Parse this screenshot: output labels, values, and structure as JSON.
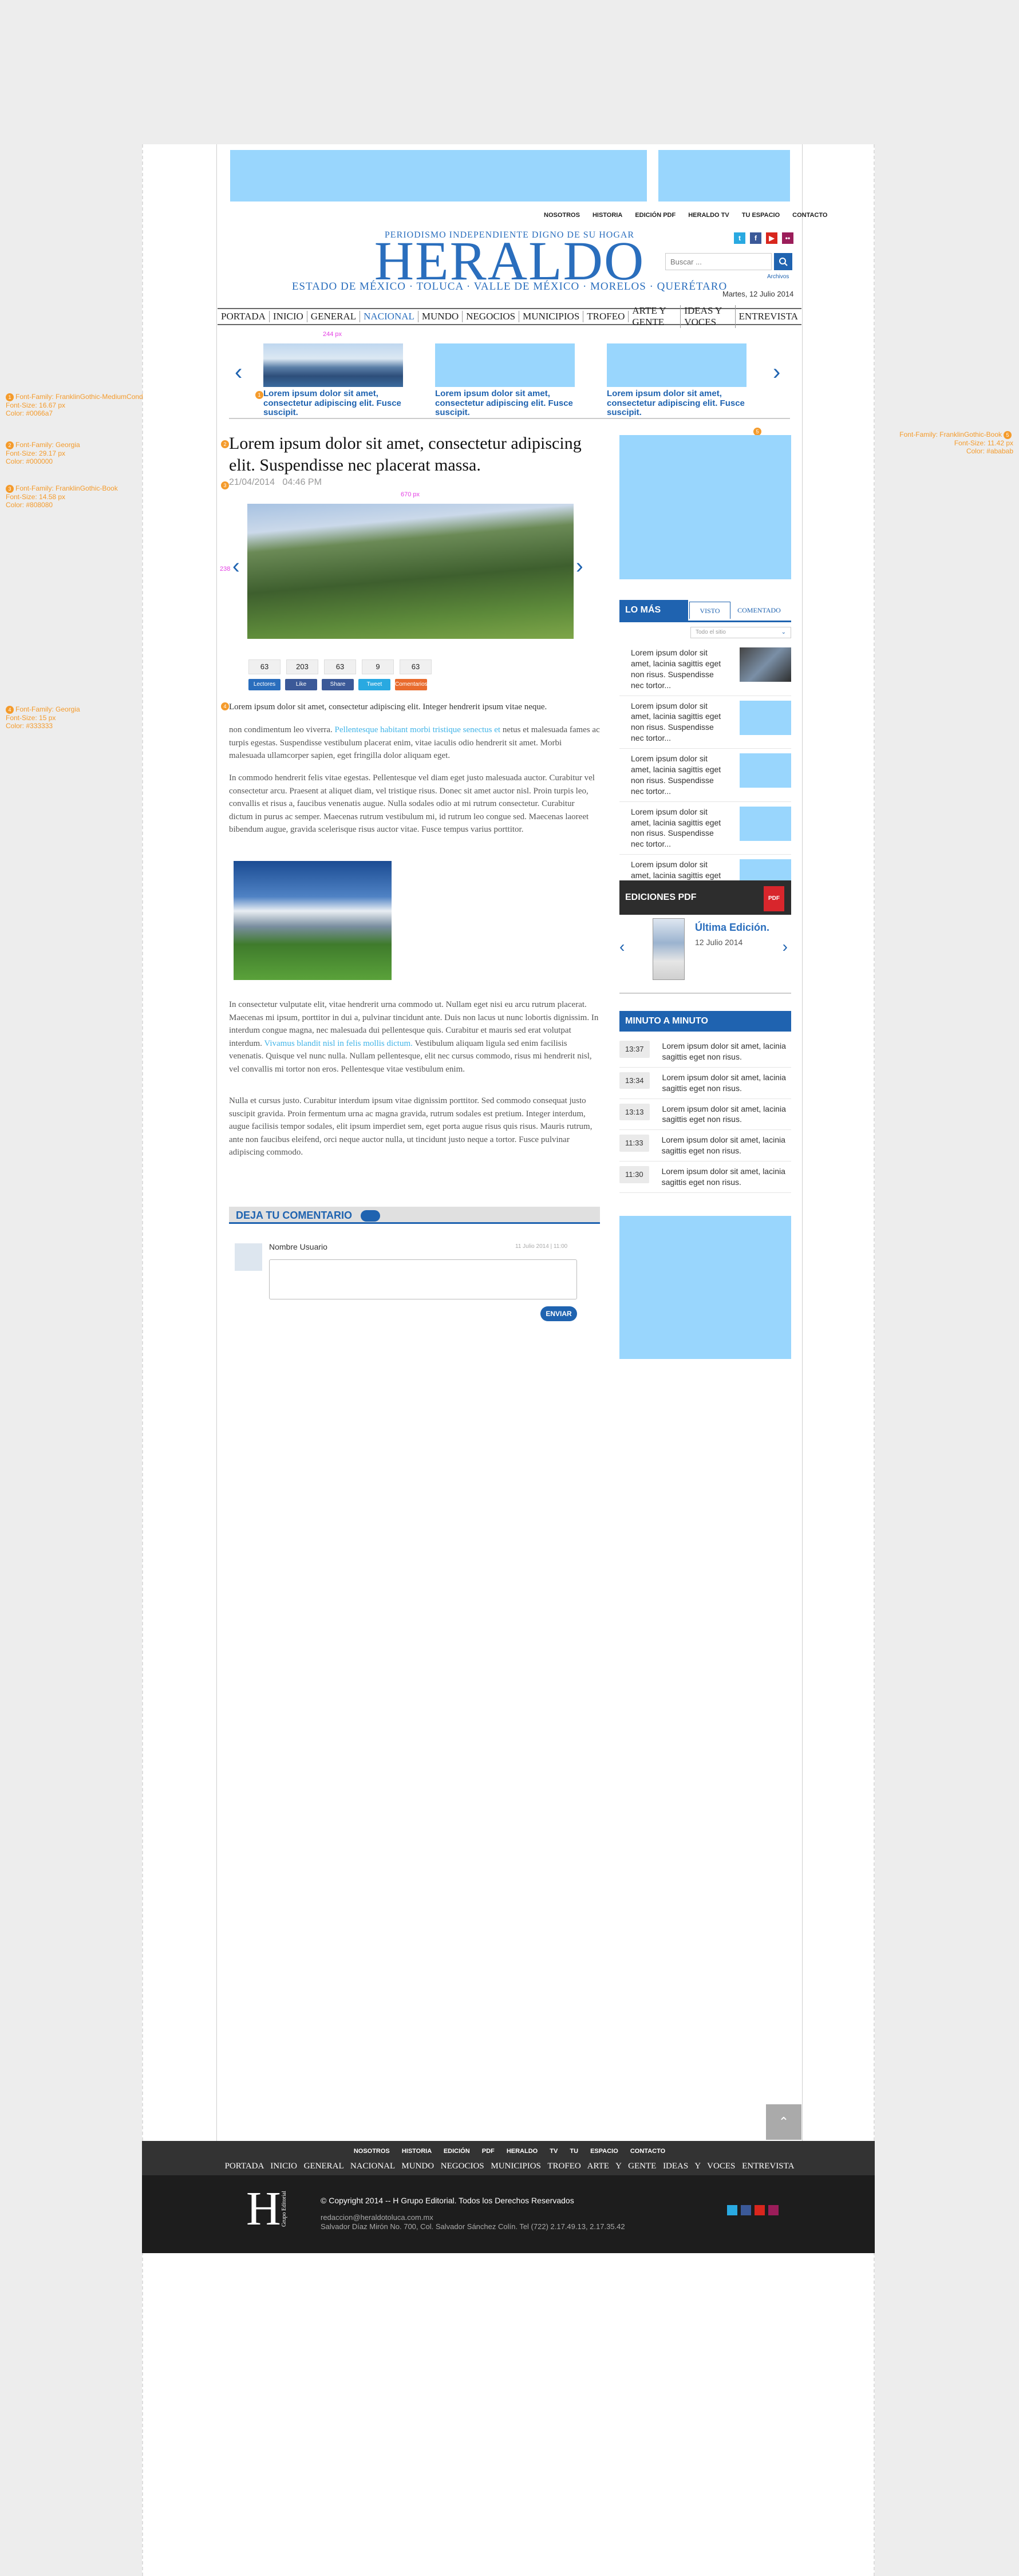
{
  "header": {
    "top_links": [
      "NOSOTROS",
      "HISTORIA",
      "EDICIÓN PDF",
      "HERALDO TV",
      "TU ESPACIO",
      "CONTACTO"
    ],
    "tagline": "PERIODISMO INDEPENDIENTE DIGNO DE SU HOGAR",
    "logo": "HERALDO",
    "subtag": "ESTADO DE MÉXICO · TOLUCA · VALLE DE MÉXICO · MORELOS · QUERÉTARO",
    "search_placeholder": "Buscar ...",
    "archive_label": "Archivos",
    "date": "Martes, 12 Julio 2014"
  },
  "nav": {
    "items": [
      "PORTADA",
      "INICIO",
      "GENERAL",
      "NACIONAL",
      "MUNDO",
      "NEGOCIOS",
      "MUNICIPIOS",
      "TROFEO",
      "ARTE Y GENTE",
      "IDEAS Y VOCES",
      "ENTREVISTA"
    ],
    "active": "NACIONAL"
  },
  "carousel": {
    "items": [
      {
        "caption": "Lorem ipsum dolor sit amet, consectetur adipiscing elit. Fusce suscipit."
      },
      {
        "caption": "Lorem ipsum dolor sit amet, consectetur adipiscing elit. Fusce suscipit."
      },
      {
        "caption": "Lorem ipsum dolor sit amet, consectetur adipiscing elit. Fusce suscipit."
      }
    ],
    "dim_label": "244 px"
  },
  "annotations": {
    "a1": [
      "Font-Family: FranklinGothic-MediumCond",
      "Font-Size: 16.67 px",
      "Color: #0066a7"
    ],
    "a2": [
      "Font-Family: Georgia",
      "Font-Size: 29.17 px",
      "Color: #000000"
    ],
    "a3": [
      "Font-Family: FranklinGothic-Book",
      "Font-Size: 14.58 px",
      "Color: #808080"
    ],
    "a4": [
      "Font-Family: Georgia",
      "Font-Size: 15 px",
      "Color: #333333"
    ],
    "a5": [
      "Font-Family: FranklinGothic-Book",
      "Font-Size: 11.42 px",
      "Color: #ababab"
    ],
    "img_w": "670 px",
    "img_h": "238"
  },
  "article": {
    "title": "Lorem ipsum dolor sit amet, consectetur adipiscing elit. Suspendisse nec placerat massa.",
    "date": "21/04/2014",
    "time": "04:46 PM",
    "counters": [
      "63",
      "203",
      "63",
      "9",
      "63"
    ],
    "shares": [
      "Lectores",
      "Like",
      "Share",
      "Tweet",
      "Comentarios"
    ],
    "lead": "Lorem ipsum dolor sit amet, consectetur adipiscing elit. Integer hendrerit ipsum vitae neque.",
    "p1_a": "non condimentum leo viverra. ",
    "p1_link": "Pellentesque habitant morbi tristique senectus et",
    "p1_b": " netus et malesuada fames ac turpis egestas. Suspendisse vestibulum placerat enim, vitae iaculis odio hendrerit sit amet. Morbi malesuada ullamcorper sapien, eget fringilla dolor aliquam eget.",
    "p2": "In commodo hendrerit felis vitae egestas. Pellentesque vel diam eget justo malesuada auctor. Curabitur vel consectetur arcu. Praesent at aliquet diam, vel tristique risus. Donec sit amet auctor nisl. Proin turpis leo, convallis et risus a, faucibus venenatis augue. Nulla sodales odio at mi rutrum consectetur. Curabitur dictum in purus ac semper. Maecenas rutrum vestibulum mi, id rutrum leo congue sed. Maecenas laoreet bibendum augue, gravida scelerisque risus auctor vitae. Fusce tempus varius porttitor.",
    "p3_a": "In consectetur vulputate elit, vitae hendrerit urna commodo ut. Nullam eget nisi eu arcu rutrum placerat. Maecenas mi ipsum, porttitor in dui a, pulvinar tincidunt ante. Duis non lacus ut nunc lobortis dignissim. In interdum congue magna, nec malesuada dui pellentesque quis. Curabitur et mauris sed erat volutpat interdum. ",
    "p3_link": "Vivamus blandit nisl in felis mollis dictum.",
    "p3_b": " Vestibulum aliquam ligula sed enim facilisis venenatis. Quisque vel nunc nulla. Nullam pellentesque, elit nec cursus commodo, risus mi hendrerit nisl, vel convallis mi tortor non eros. Pellentesque vitae vestibulum enim.",
    "p4": "Nulla et cursus justo. Curabitur interdum ipsum vitae dignissim porttitor. Sed commodo consequat justo suscipit gravida. Proin fermentum urna ac magna gravida, rutrum sodales est pretium. Integer interdum, augue facilisis tempor sodales, elit ipsum imperdiet sem, eget porta augue risus quis risus. Mauris rutrum, ante non faucibus eleifend, orci neque auctor nulla, ut tincidunt justo neque a tortor. Fusce pulvinar adipiscing commodo."
  },
  "comments": {
    "heading": "DEJA TU COMENTARIO",
    "user": "Nombre Usuario",
    "timestamp": "11 Julio 2014 | 11:00",
    "submit": "ENVIAR"
  },
  "sidebar": {
    "lo_mas": "LO MÁS",
    "tabs": [
      "VISTO",
      "COMENTADO"
    ],
    "filter": "Todo el sitio",
    "items": [
      "Lorem ipsum dolor sit amet, lacinia sagittis eget non risus. Suspendisse nec tortor...",
      "Lorem ipsum dolor sit amet, lacinia sagittis eget non risus. Suspendisse nec tortor...",
      "Lorem ipsum dolor sit amet, lacinia sagittis eget non risus. Suspendisse nec tortor...",
      "Lorem ipsum dolor sit amet, lacinia sagittis eget non risus. Suspendisse nec tortor...",
      "Lorem ipsum dolor sit amet, lacinia sagittis eget non risus. Suspendisse nec tortor..."
    ],
    "pdf_head": "EDICIONES PDF",
    "pdf_badge": "PDF",
    "pdf_title": "Última Edición.",
    "pdf_date": "12 Julio 2014",
    "minute_head": "MINUTO A MINUTO",
    "minutes": [
      {
        "time": "13:37",
        "text": "Lorem ipsum dolor sit amet, lacinia sagittis eget non risus."
      },
      {
        "time": "13:34",
        "text": "Lorem ipsum dolor sit amet, lacinia sagittis eget non risus."
      },
      {
        "time": "13:13",
        "text": "Lorem ipsum dolor sit amet, lacinia sagittis eget non risus."
      },
      {
        "time": "11:33",
        "text": "Lorem ipsum dolor sit amet, lacinia sagittis eget non risus."
      },
      {
        "time": "11:30",
        "text": "Lorem ipsum dolor sit amet, lacinia sagittis eget non risus."
      }
    ]
  },
  "footer": {
    "links": [
      "NOSOTROS",
      "HISTORIA",
      "EDICIÓN PDF",
      "HERALDO TV",
      "TU ESPACIO",
      "CONTACTO"
    ],
    "nav": [
      "PORTADA",
      "INICIO",
      "GENERAL",
      "NACIONAL",
      "MUNDO",
      "NEGOCIOS",
      "MUNICIPIOS",
      "TROFEO",
      "ARTE Y GENTE",
      "IDEAS Y VOCES",
      "ENTREVISTA"
    ],
    "logo_letter": "H",
    "logo_sub": "Grupo Editorial",
    "copyright": "© Copyright 2014 -- H Grupo Editorial. Todos los Derechos Reservados",
    "email": "redaccion@heraldotoluca.com.mx",
    "address": "Salvador Díaz Mirón No. 700, Col. Salvador Sánchez Colín. Tel (722) 2.17.49.13, 2.17.35.42"
  },
  "colors": {
    "brand": "#2a6ebd",
    "accent": "#1f63b0",
    "ad": "#99d6fd",
    "annotation": "#f49b2c"
  }
}
